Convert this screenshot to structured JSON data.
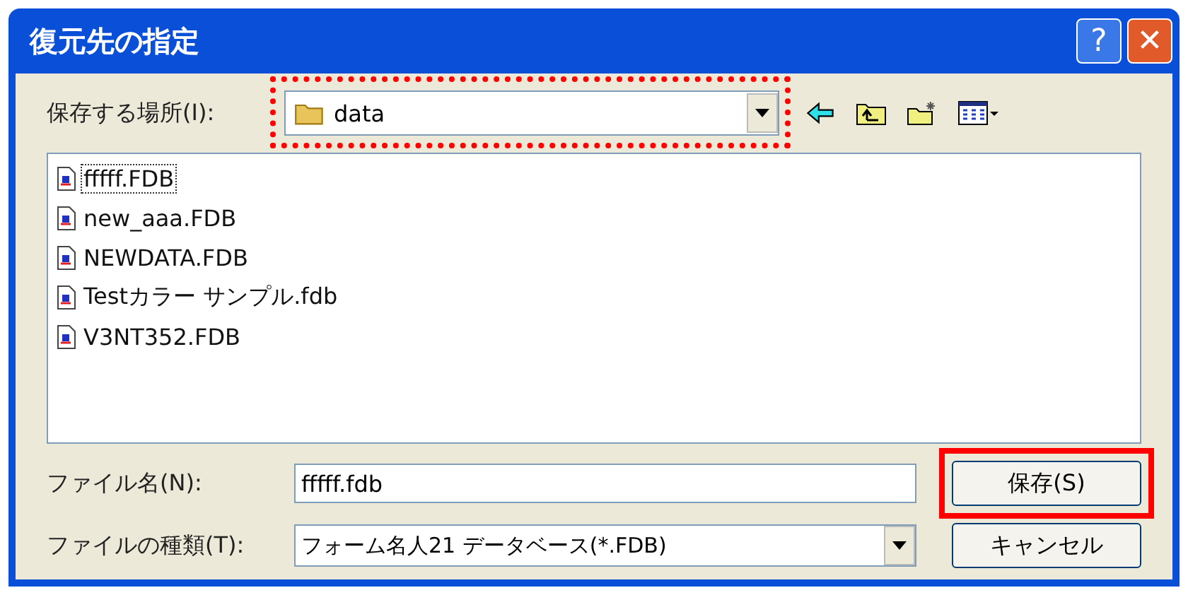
{
  "window": {
    "title": "復元先の指定"
  },
  "title_buttons": [
    {
      "kind": "help",
      "label": "?"
    },
    {
      "kind": "close",
      "label": "✕"
    }
  ],
  "location": {
    "label": "保存する場所(I):",
    "value": "data",
    "highlighted": true
  },
  "toolbar": [
    {
      "kind": "back"
    },
    {
      "kind": "up"
    },
    {
      "kind": "new-folder"
    },
    {
      "kind": "view"
    }
  ],
  "files": [
    {
      "name": "fffff.FDB",
      "selected": true
    },
    {
      "name": "new_aaa.FDB",
      "selected": false
    },
    {
      "name": "NEWDATA.FDB",
      "selected": false
    },
    {
      "name": "Testカラー サンプル.fdb",
      "selected": false
    },
    {
      "name": "V3NT352.FDB",
      "selected": false
    }
  ],
  "filename": {
    "label": "ファイル名(N):",
    "value": "fffff.fdb"
  },
  "filetype": {
    "label": "ファイルの種類(T):",
    "value": "フォーム名人21 データベース(*.FDB)"
  },
  "buttons": [
    {
      "label": "保存(S)",
      "highlighted": true
    },
    {
      "label": "キャンセル",
      "highlighted": false
    }
  ]
}
